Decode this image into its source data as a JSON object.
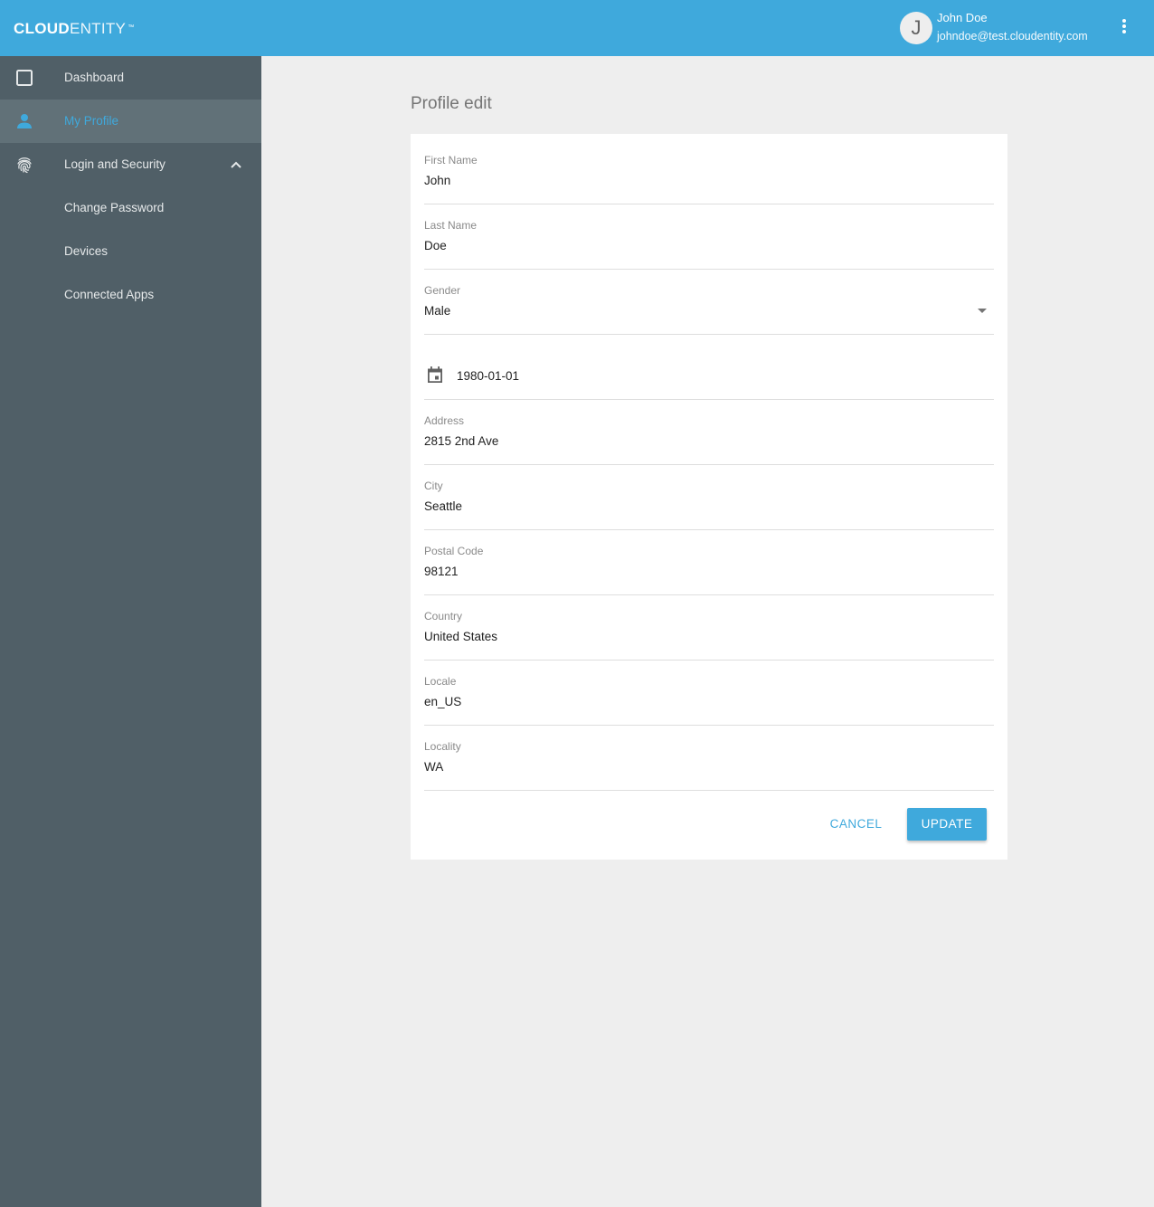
{
  "header": {
    "logo_bold": "CLOUD",
    "logo_light": "ENTITY",
    "logo_tm": "™",
    "user": {
      "avatar_initial": "J",
      "name": "John Doe",
      "email": "johndoe@test.cloudentity.com"
    },
    "more_menu_icon": "more-vert-icon"
  },
  "sidebar": {
    "items": [
      {
        "label": "Dashboard",
        "icon": "dashboard-square-icon",
        "active": false
      },
      {
        "label": "My Profile",
        "icon": "person-icon",
        "active": true
      },
      {
        "label": "Login and Security",
        "icon": "fingerprint-icon",
        "active": false,
        "expanded": true
      },
      {
        "label": "Change Password",
        "sub": true
      },
      {
        "label": "Devices",
        "sub": true
      },
      {
        "label": "Connected Apps",
        "sub": true
      }
    ]
  },
  "main": {
    "title": "Profile edit",
    "fields": {
      "first_name": {
        "label": "First Name",
        "value": "John"
      },
      "last_name": {
        "label": "Last Name",
        "value": "Doe"
      },
      "gender": {
        "label": "Gender",
        "value": "Male"
      },
      "birthdate": {
        "label": "",
        "value": "1980-01-01"
      },
      "address": {
        "label": "Address",
        "value": "2815 2nd Ave"
      },
      "city": {
        "label": "City",
        "value": "Seattle"
      },
      "postal_code": {
        "label": "Postal Code",
        "value": "98121"
      },
      "country": {
        "label": "Country",
        "value": "United States"
      },
      "locale": {
        "label": "Locale",
        "value": "en_US"
      },
      "locality": {
        "label": "Locality",
        "value": "WA"
      }
    },
    "buttons": {
      "cancel": "CANCEL",
      "update": "UPDATE"
    }
  },
  "colors": {
    "brand": "#3fa9dc",
    "sidebar": "#505f67",
    "sidebar_active": "#617178",
    "background": "#eeeeee"
  }
}
